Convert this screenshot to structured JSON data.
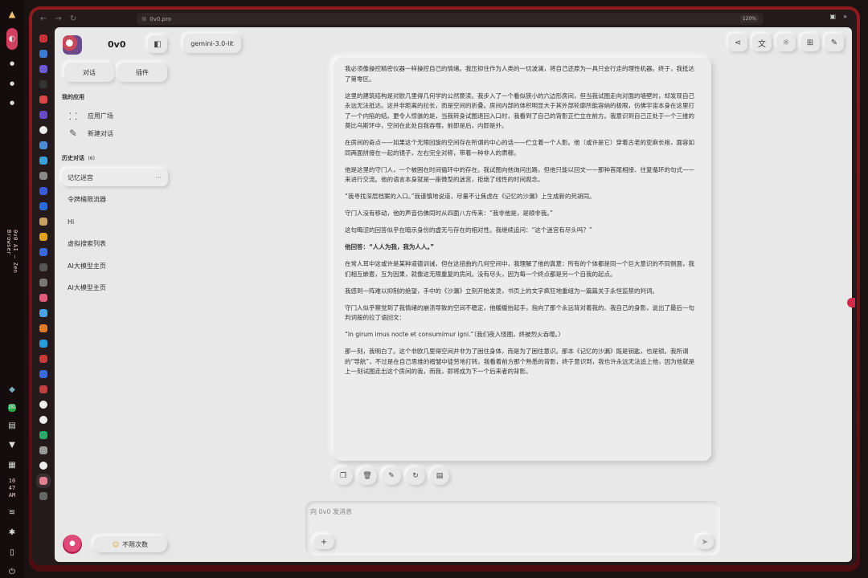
{
  "os_bar": {
    "vertical_title": "0v0 AI — Zen Browser",
    "clock": [
      "10",
      "47",
      "AM"
    ]
  },
  "browser": {
    "url": "0v0.pro",
    "zoom": "120%"
  },
  "app": {
    "title": "0v0",
    "model": "gemini-3.0-lit",
    "buttons": {
      "chat": "对话",
      "plugins": "插件"
    },
    "my_apps_label": "我的应用",
    "apps": [
      {
        "icon": "grid-icon",
        "label": "应用广场"
      },
      {
        "icon": "edit-icon",
        "label": "新建对话"
      }
    ],
    "history_label": "历史对话",
    "history_count": "(6)",
    "history": [
      {
        "label": "记忆迷宫",
        "active": true
      },
      {
        "label": "令牌桶限流器"
      },
      {
        "label": "Hi"
      },
      {
        "label": "虚拟搜索列表"
      },
      {
        "label": "AI大模型主页"
      },
      {
        "label": "AI大模型主页"
      }
    ],
    "quota": "不限次数",
    "composer_placeholder": "向 0v0 发消息",
    "top_actions": [
      "share-icon",
      "translate-icon",
      "theme-icon",
      "apps-grid-icon",
      "compose-icon"
    ],
    "message_actions": [
      "copy-icon",
      "delete-icon",
      "edit-icon",
      "regenerate-icon",
      "export-icon"
    ]
  },
  "message": {
    "p1": "我必须像操控精密仪器一样操控自己的情绪。我压抑住作为人类的一切波澜，将自己还原为一具只会行走的理性机器。终于，我抵达了第零区。",
    "p2": "这里的建筑结构是对欧几里得几何学的公然亵渎。我步入了一个看似狭小的六边形房间，但当我试图走向对面的墙壁时，却发现自己永远无法抵达。这并非距离的拉长，而是空间的折叠。房间内部的体积明显大于其外部轮廓所能容纳的极限，仿佛宇宙本身在这里打了一个内陷的结。更令人惊骇的是，当我转身试图退回入口时，我看到了自己的背影正伫立在前方。我意识到自己正处于一个三维的莫比乌斯环中，空间在此处自我吞噬，前即是后，内即是外。",
    "p3": "在房间的奇点——如果这个无限回旋的空间存在所谓的中心的话——伫立着一个人影。他（或许是它）穿着古老的亚麻长袍，面容如同两面拼接在一起的镜子，左右完全对称，带着一种非人的肃穆。",
    "p4": "他是这里的守门人，一个被困在时间循环中的存在。我试图向他询问出路，但他只能以回文——那种首尾相接、往复循环的句式——来进行交流。他的语言本身就是一座微型的迷宫，拒绝了线性的时间观念。",
    "p5": "“我寻找深层档案的入口。”我谨慎地说道，尽量不让焦虑在《记忆的沙漏》上生成新的死胡同。",
    "p6": "守门人没有移动，他的声音仿佛同时从四面八方传来：“我非他是，是顺非我。”",
    "p7": "这句晦涩的回答似乎在暗示身份的虚无与存在的相对性。我继续追问：“这个迷宫有尽头吗？”",
    "p8": "他回答：“人人为我，我为人人。”",
    "p9": "在常人耳中这或许是某种道德训诫，但在这扭曲的几何空间中，我理解了他的真意：所有的个体都是同一个巨大意识的不同侧面，我们相互嵌套，互为因果，就像这无限重复的房间。没有尽头，因为每一个终点都是另一个自我的起点。",
    "p10": "我感到一阵难以抑制的绝望，手中的《沙漏》立刻开始发烫，书页上的文字疯狂地重组为一篇篇关于永恒监禁的判词。",
    "p11": "守门人似乎察觉到了我情绪的崩溃导致的空间不稳定，他缓缓抬起手，指向了那个永远背对着我的、我自己的身影，说出了最后一句判词般的拉丁语回文：",
    "p12": "“In girum imus nocte et consumimur igni.”（我们夜入怪圈，终被烈火吞噬。）",
    "p13": "那一刻，我明白了。这个非欧几里得空间并非为了困住身体，而是为了困住意识。那本《记忆的沙漏》既是钥匙，也是锁。我所谓的“导航”，不过是在自己思维的褶皱中徒劳地打转。我看着前方那个熟悉的背影，终于意识到，我也许永远无法追上他，因为他就是上一刻试图走出这个房间的我，而我，即将成为下一个后来者的背影。"
  }
}
